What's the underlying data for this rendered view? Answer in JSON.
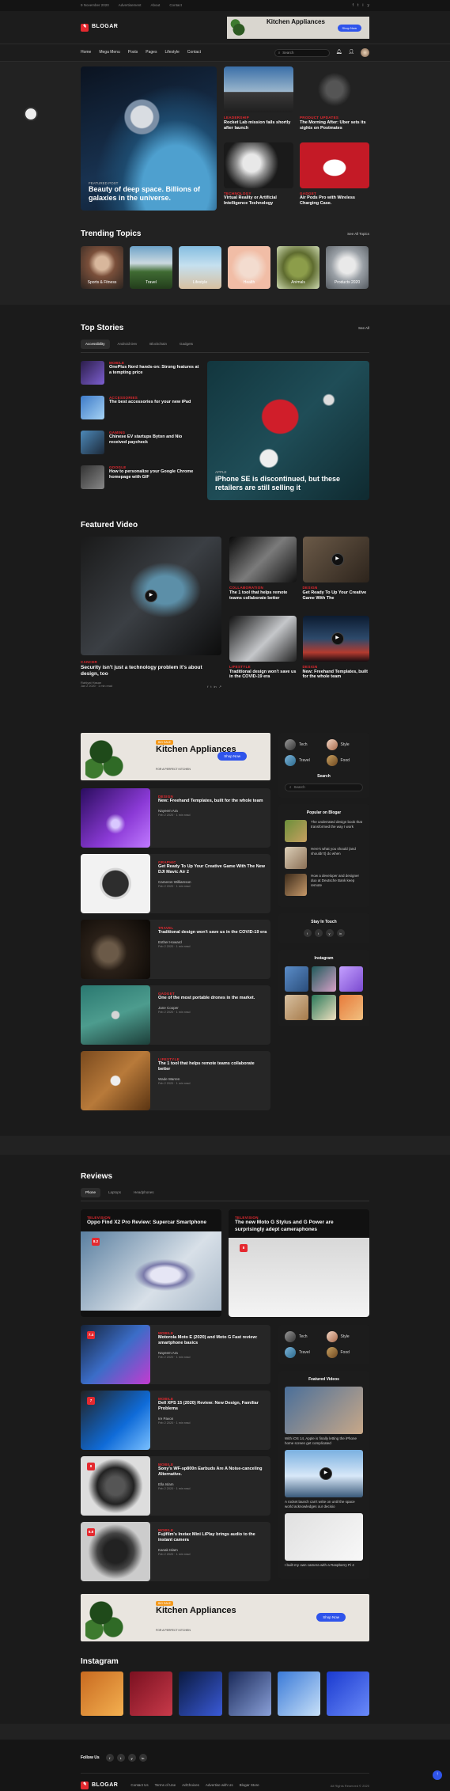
{
  "topbar": {
    "date": "9 November 2020",
    "links": [
      "Advertisement",
      "About",
      "Contact"
    ],
    "socials": [
      "f",
      "t",
      "i",
      "y"
    ]
  },
  "header": {
    "logo": "BLOGAR",
    "ad": {
      "title": "Kitchen Appliances",
      "button": "Shop Now"
    }
  },
  "nav": {
    "items": [
      "Home",
      "Mega Menu",
      "Posts",
      "Pages",
      "Lifestyle",
      "Contact"
    ],
    "search_placeholder": "Search"
  },
  "hero": {
    "main": {
      "tag": "FEATURED POST",
      "title": "Beauty of deep space. Billions of galaxies in the universe."
    },
    "grid": [
      {
        "cat": "LEADERSHIP",
        "title": "Rocket Lab mission fails shortly after launch"
      },
      {
        "cat": "PRODUCT UPDATES",
        "title": "The Morning After: Uber sets its sights on Postmates"
      },
      {
        "cat": "TECHNOLOGY",
        "title": "Virtual Reality or Artificial Intelligence Technology"
      },
      {
        "cat": "GADGET",
        "title": "Air Pods Pro with Wireless Charging Case."
      }
    ]
  },
  "trending": {
    "title": "Trending Topics",
    "see_all": "See All Topics",
    "topics": [
      "Sports & Fitness",
      "Travel",
      "Lifestyle",
      "Health",
      "Animals",
      "Products 2020"
    ]
  },
  "top_stories": {
    "title": "Top Stories",
    "see_all": "See All",
    "tabs": [
      "Accessibility",
      "Android Dev",
      "Blockchain",
      "Gadgets"
    ],
    "items": [
      {
        "cat": "MOBILE",
        "title": "OnePlus Nord hands-on: Strong features at a tempting price"
      },
      {
        "cat": "ACCESSORIES",
        "title": "The best accessories for your new iPad"
      },
      {
        "cat": "GAMING",
        "title": "Chinese EV startups Byton and Nio received paycheck"
      },
      {
        "cat": "GOOGLE",
        "title": "How to personalize your Google Chrome homepage with GIF"
      }
    ],
    "big": {
      "cat": "APPLE",
      "title": "iPhone SE is discontinued, but these retailers are still selling it"
    }
  },
  "featured_video": {
    "title": "Featured Video",
    "main": {
      "cat": "CANCER",
      "title": "Security isn't just a technology problem it's about design, too",
      "author": "Rahiyat Hasan",
      "date": "Jan 2 2020 · 1 min read"
    },
    "grid": [
      {
        "cat": "COLLABORATION",
        "title": "The 1 tool that helps remote teams collaborate better"
      },
      {
        "cat": "DESIGN",
        "title": "Get Ready To Up Your Creative Game With The"
      },
      {
        "cat": "LIFESTYLE",
        "title": "Traditional design won't save us in the COVID-19 era"
      },
      {
        "cat": "DESIGN",
        "title": "New: Freehand Templates, built for the whole team"
      }
    ]
  },
  "ad_big": {
    "tag": "BIG SALE",
    "title": "Kitchen Appliances",
    "sub": "FOR A PERFECT KITCHEN",
    "button": "Shop Now"
  },
  "articles": [
    {
      "cat": "DESIGN",
      "title": "New: Freehand Templates, built for the whole team",
      "author": "Nayeem Ara",
      "date": "Feb 2 2020 · 1 min read"
    },
    {
      "cat": "GRAPHIC",
      "title": "Get Ready To Up Your Creative Game With The New DJI Mavic Air 2",
      "author": "Cameron Williamson",
      "date": "Feb 2 2020 · 1 min read"
    },
    {
      "cat": "TRAVEL",
      "title": "Traditional design won't save us in the COVID-19 era",
      "author": "Esther Howard",
      "date": "Feb 2 2020 · 1 min read"
    },
    {
      "cat": "GADGET",
      "title": "One of the most portable drones in the market.",
      "author": "Jane Cooper",
      "date": "Feb 2 2020 · 1 min read"
    },
    {
      "cat": "LIFESTYLE",
      "title": "The 1 tool that helps remote teams collaborate better",
      "author": "Wade Warren",
      "date": "Feb 2 2020 · 1 min read"
    }
  ],
  "sidebar": {
    "categories": [
      "Tech",
      "Style",
      "Travel",
      "Food"
    ],
    "search_title": "Search",
    "search_placeholder": "Search",
    "popular_title": "Popular on Blogar",
    "popular": [
      "The underrated design book that transformed the way I work",
      "Here's what you should (and shouldn't) do when",
      "How a developer and designer duo at Deutsche Bank keep remote"
    ],
    "stay_title": "Stay In Touch",
    "social": [
      "f",
      "t",
      "y",
      "in"
    ],
    "insta_title": "Instagram"
  },
  "reviews": {
    "title": "Reviews",
    "tabs": [
      "Phone",
      "Laptops",
      "Headphones"
    ],
    "top": [
      {
        "cat": "TELEVISION",
        "title": "Oppo Find X2 Pro Review: Supercar Smartphone",
        "score": "8.2"
      },
      {
        "cat": "TELEVISION",
        "title": "The new Moto G Stylus and G Power are surprisingly adept cameraphones",
        "score": "8"
      }
    ],
    "list": [
      {
        "cat": "MOBILE",
        "title": "Motorola Moto E (2020) and Moto G Fast review: smartphone basics",
        "score": "7.4",
        "author": "Nayeem Ara",
        "date": "Feb 2 2020 · 1 min read"
      },
      {
        "cat": "MOBILE",
        "title": "Dell XPS 15 (2020) Review: New Design, Familiar Problems",
        "score": "7",
        "author": "Ire Pavon",
        "date": "Feb 2 2020 · 1 min read"
      },
      {
        "cat": "MOBILE",
        "title": "Sony's WF-sp800n Earbuds Are A Noise-canceling Alternative.",
        "score": "8",
        "author": "Ella Islam",
        "date": "Feb 2 2020 · 1 min read"
      },
      {
        "cat": "MOBILE",
        "title": "Fujifilm's Instax Mini LiPlay brings audio to the instant camera",
        "score": "6.8",
        "author": "Kanak Islam",
        "date": "Feb 2 2020 · 1 min read"
      }
    ],
    "side_videos_title": "Featured Videos",
    "side_videos": [
      "With iOS 14, Apple is finally letting the iPhone home screen get complicated",
      "A rocket launch can't write on until the space world acknowledges our decisio",
      "I built my own camera with a Raspberry Pi 4"
    ]
  },
  "instagram": {
    "title": "Instagram"
  },
  "footer": {
    "follow": "Follow Us",
    "logo": "BLOGAR",
    "links": [
      "Contact Us",
      "Terms of Use",
      "AdChoices",
      "Advertise with Us",
      "Blogar Store"
    ],
    "copyright": "All Rights Reserved © 2020"
  }
}
